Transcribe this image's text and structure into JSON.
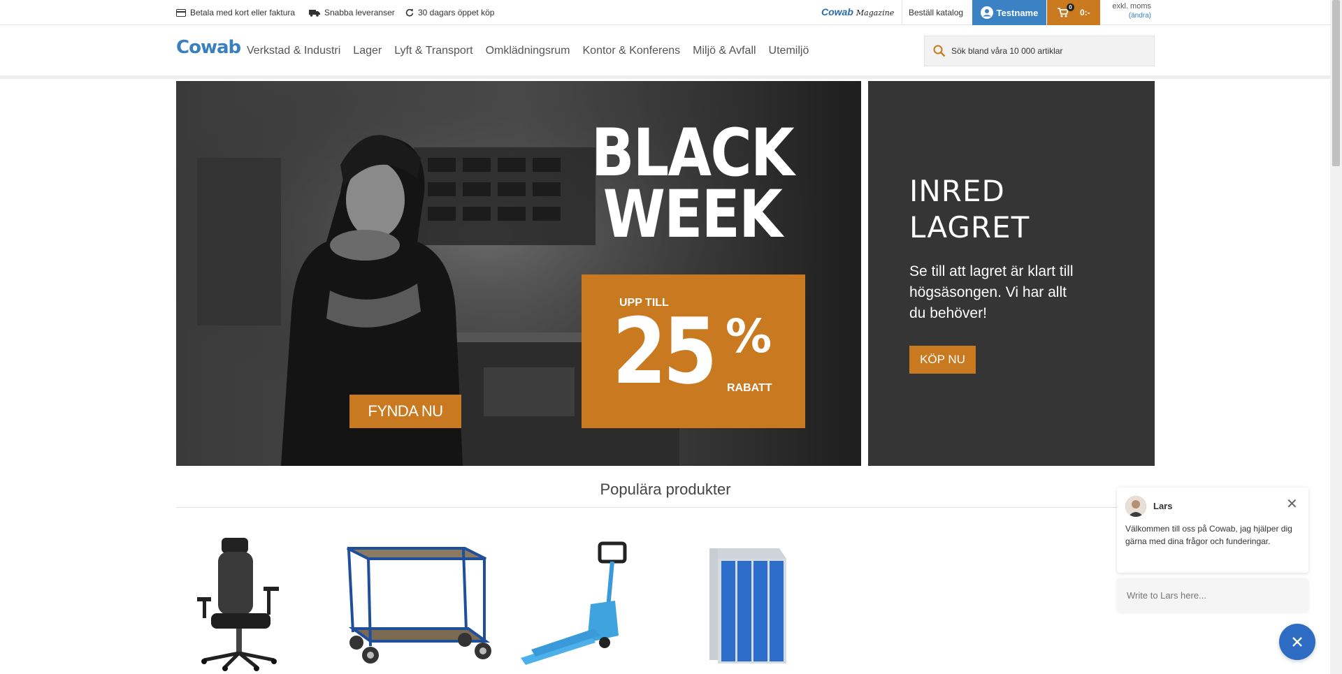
{
  "topbar": {
    "usps": [
      {
        "icon": "credit-card-icon",
        "label": "Betala med kort eller faktura"
      },
      {
        "icon": "truck-icon",
        "label": "Snabba leveranser"
      },
      {
        "icon": "refresh-icon",
        "label": "30 dagars öppet köp"
      }
    ],
    "magazine_logo": "Cowab",
    "magazine_word": "Magazine",
    "catalog_label": "Beställ katalog",
    "user_label": "Testname",
    "cart_count": "0",
    "cart_total": "0:-",
    "vat_label": "exkl. moms",
    "vat_change": "(ändra)"
  },
  "header": {
    "logo": "Cowab",
    "nav": [
      "Verkstad & Industri",
      "Lager",
      "Lyft & Transport",
      "Omklädningsrum",
      "Kontor & Konferens",
      "Miljö & Avfall",
      "Utemiljö"
    ],
    "search_placeholder": "Sök bland våra 10 000 artiklar"
  },
  "hero_main": {
    "title_line1": "BLACK",
    "title_line2": "WEEK",
    "offer_prefix": "UPP TILL",
    "offer_number": "25",
    "offer_percent": "%",
    "offer_suffix": "RABATT",
    "cta": "FYNDA NU"
  },
  "hero_side": {
    "title_line1": "INRED",
    "title_line2": "LAGRET",
    "text": "Se till att lagret är klart till högsäsongen. Vi har allt du behöver!",
    "cta": "KÖP NU"
  },
  "popular": {
    "title": "Populära produkter"
  },
  "chat": {
    "agent_name": "Lars",
    "message": "Välkommen till oss på Cowab, jag hjälper dig gärna med dina frågor och funderingar.",
    "input_placeholder": "Write to Lars here...",
    "close_glyph": "✕"
  },
  "colors": {
    "brand_blue": "#3a82c4",
    "accent_orange": "#c9791f",
    "dark_panel": "#353535"
  }
}
